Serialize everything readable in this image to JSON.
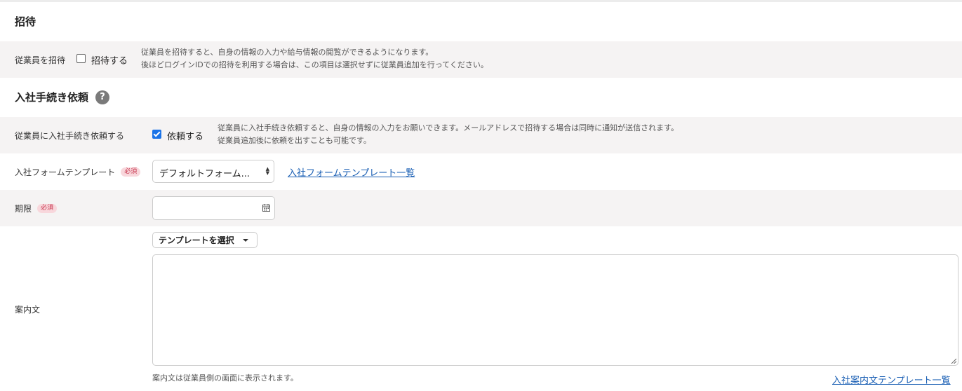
{
  "invite_section": {
    "title": "招待",
    "row_label": "従業員を招待",
    "checkbox_label": "招待する",
    "checked": false,
    "description_line1": "従業員を招待すると、自身の情報の入力や給与情報の閲覧ができるようになります。",
    "description_line2": "後ほどログインIDでの招待を利用する場合は、この項目は選択せずに従業員追加を行ってください。"
  },
  "onboarding_section": {
    "title": "入社手続き依頼",
    "help_icon": "?",
    "request_row": {
      "label": "従業員に入社手続き依頼する",
      "checkbox_label": "依頼する",
      "checked": true,
      "description_line1": "従業員に入社手続き依頼すると、自身の情報の入力をお願いできます。メールアドレスで招待する場合は同時に通知が送信されます。",
      "description_line2": "従業員追加後に依頼を出すことも可能です。"
    },
    "form_template_row": {
      "label": "入社フォームテンプレート",
      "required_badge": "必須",
      "selected_value": "デフォルトフォーム...",
      "link": "入社フォームテンプレート一覧"
    },
    "deadline_row": {
      "label": "期限",
      "required_badge": "必須",
      "value": ""
    },
    "guidance_row": {
      "label": "案内文",
      "template_button": "テンプレートを選択",
      "textarea_value": "",
      "note": "案内文は従業員側の画面に表示されます。",
      "link": "入社案内文テンプレート一覧"
    }
  }
}
